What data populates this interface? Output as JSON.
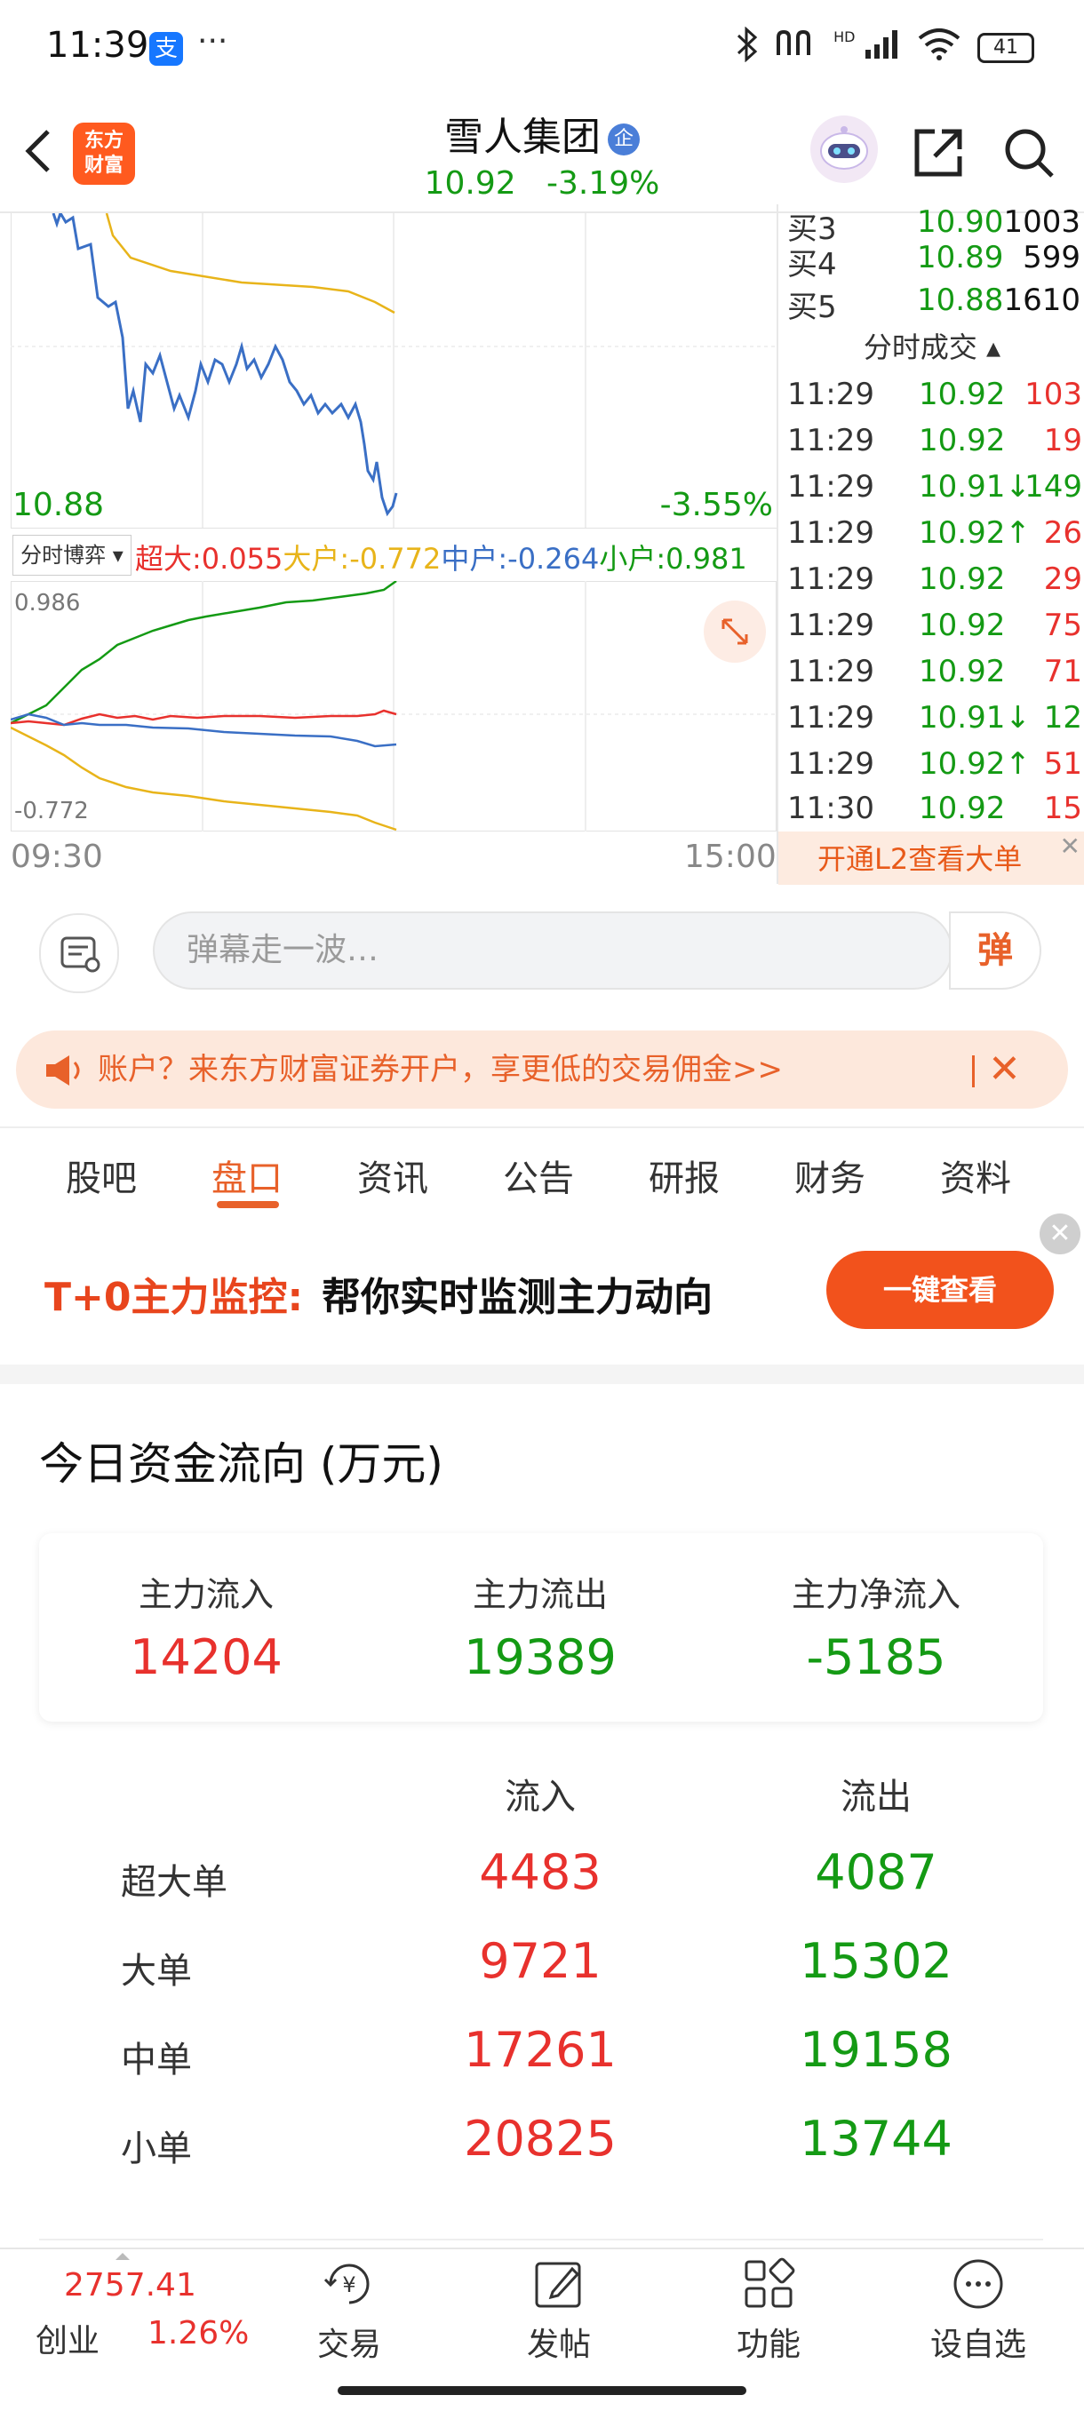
{
  "status_bar": {
    "time": "11:39",
    "alipay_icon": "支",
    "dots": "···",
    "network_label": "HD",
    "battery": "41"
  },
  "header": {
    "logo_text_line1": "东方",
    "logo_text_line2": "财富",
    "stock_name": "雪人集团",
    "badge": "企",
    "price": "10.92",
    "change_pct": "-3.19%"
  },
  "chart": {
    "low_price": "10.88",
    "low_pct": "-3.55%",
    "fund_selector": "分时博弈 ▾",
    "legend": {
      "super": "超大:0.055",
      "large": "大户:-0.772",
      "mid": "中户:-0.264",
      "small": "小户:0.981"
    },
    "fund_top": "0.986",
    "fund_bottom": "-0.772",
    "time_start": "09:30",
    "time_end": "15:00"
  },
  "order_book": [
    {
      "label": "买3",
      "price": "10.90",
      "vol": "1003"
    },
    {
      "label": "买4",
      "price": "10.89",
      "vol": "599"
    },
    {
      "label": "买5",
      "price": "10.88",
      "vol": "1610"
    }
  ],
  "ticks_title": "分时成交 ▴",
  "ticks": [
    {
      "time": "11:29",
      "price": "10.92",
      "vol": "103",
      "color": "#e8312d"
    },
    {
      "time": "11:29",
      "price": "10.92",
      "vol": "19",
      "color": "#e8312d"
    },
    {
      "time": "11:29",
      "price": "10.91↓",
      "vol": "149",
      "color": "#149a14"
    },
    {
      "time": "11:29",
      "price": "10.92↑",
      "vol": "26",
      "color": "#e8312d"
    },
    {
      "time": "11:29",
      "price": "10.92",
      "vol": "29",
      "color": "#e8312d"
    },
    {
      "time": "11:29",
      "price": "10.92",
      "vol": "75",
      "color": "#e8312d"
    },
    {
      "time": "11:29",
      "price": "10.92",
      "vol": "71",
      "color": "#e8312d"
    },
    {
      "time": "11:29",
      "price": "10.91↓",
      "vol": "12",
      "color": "#149a14"
    },
    {
      "time": "11:29",
      "price": "10.92↑",
      "vol": "51",
      "color": "#e8312d"
    },
    {
      "time": "11:30",
      "price": "10.92",
      "vol": "15",
      "color": "#e8312d"
    }
  ],
  "l2_banner": {
    "label": "开通L2查看大单",
    "close": "✕"
  },
  "danmaku": {
    "placeholder": "弹幕走一波…",
    "button": "弹"
  },
  "promo": {
    "text": "账户？来东方财富证券开户，享更低的交易佣金>>",
    "close": "✕"
  },
  "tabs": [
    {
      "label": "股吧"
    },
    {
      "label": "盘口"
    },
    {
      "label": "资讯"
    },
    {
      "label": "公告"
    },
    {
      "label": "研报"
    },
    {
      "label": "财务"
    },
    {
      "label": "资料"
    }
  ],
  "t0_banner": {
    "title": "T+0主力监控:",
    "desc": "帮你实时监测主力动向",
    "button": "一键查看",
    "close": "✕"
  },
  "capital_flow": {
    "title": "今日资金流向 (万元)",
    "summary": [
      {
        "label": "主力流入",
        "value": "14204"
      },
      {
        "label": "主力流出",
        "value": "19389"
      },
      {
        "label": "主力净流入",
        "value": "-5185"
      }
    ],
    "col_in": "流入",
    "col_out": "流出",
    "rows": [
      {
        "label": "超大单",
        "in": "4483",
        "out": "4087"
      },
      {
        "label": "大单",
        "in": "9721",
        "out": "15302"
      },
      {
        "label": "中单",
        "in": "17261",
        "out": "19158"
      },
      {
        "label": "小单",
        "in": "20825",
        "out": "13744"
      }
    ]
  },
  "bottom_nav": {
    "index_value": "2757.41",
    "index_name": "创业",
    "index_pct": "1.26%",
    "items": [
      {
        "label": "交易",
        "icon": "trade-icon"
      },
      {
        "label": "发帖",
        "icon": "post-icon"
      },
      {
        "label": "功能",
        "icon": "function-icon"
      },
      {
        "label": "设自选",
        "icon": "add-watchlist-icon"
      }
    ]
  },
  "colors": {
    "up": "#e8312d",
    "down": "#149a14",
    "accent": "#e8612a",
    "avg_line": "#e8b41a",
    "price_line": "#3a6fc5"
  }
}
